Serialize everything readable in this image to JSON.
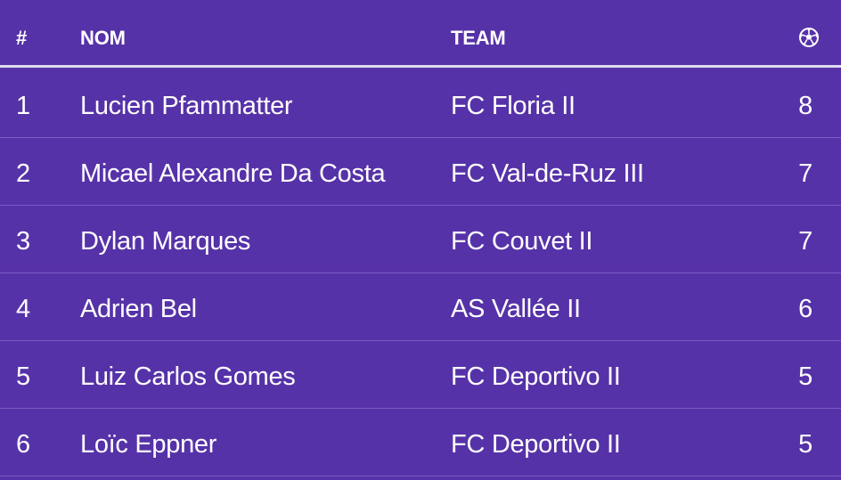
{
  "table": {
    "headers": {
      "rank": "#",
      "name": "NOM",
      "team": "TEAM",
      "goals_icon": "soccer-ball-icon"
    },
    "rows": [
      {
        "rank": "1",
        "name": "Lucien Pfammatter",
        "team": "FC Floria II",
        "goals": "8"
      },
      {
        "rank": "2",
        "name": "Micael Alexandre Da Costa",
        "team": "FC Val-de-Ruz III",
        "goals": "7"
      },
      {
        "rank": "3",
        "name": "Dylan Marques",
        "team": "FC Couvet II",
        "goals": "7"
      },
      {
        "rank": "4",
        "name": "Adrien Bel",
        "team": "AS Vallée II",
        "goals": "6"
      },
      {
        "rank": "5",
        "name": "Luiz Carlos Gomes",
        "team": "FC Deportivo II",
        "goals": "5"
      },
      {
        "rank": "6",
        "name": "Loïc Eppner",
        "team": "FC Deportivo II",
        "goals": "5"
      }
    ]
  },
  "colors": {
    "background": "#5632a8",
    "header_rule": "#dcdcec",
    "row_divider": "#7a5cc4",
    "text": "#ffffff"
  }
}
